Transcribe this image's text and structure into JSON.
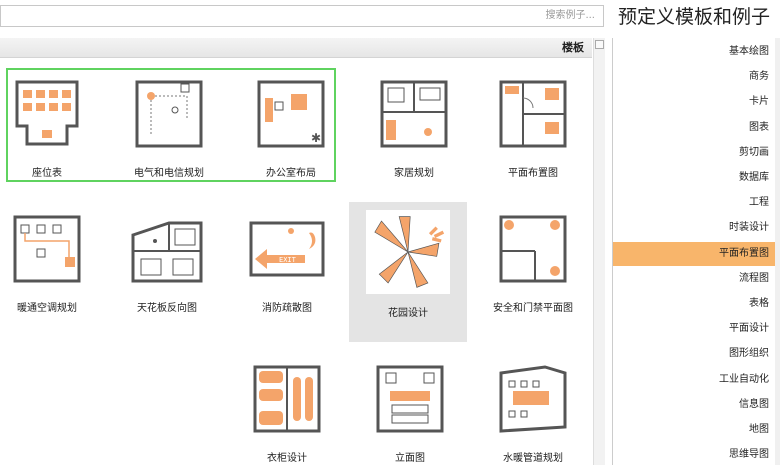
{
  "title": "预定义模板和例子",
  "search": {
    "placeholder": "搜索例子..."
  },
  "main_header": "楼板",
  "sidebar": {
    "items": [
      {
        "label": "基本绘图"
      },
      {
        "label": "商务"
      },
      {
        "label": "卡片"
      },
      {
        "label": "图表"
      },
      {
        "label": "剪切画"
      },
      {
        "label": "数据库"
      },
      {
        "label": "工程"
      },
      {
        "label": "时装设计"
      },
      {
        "label": "平面布置图",
        "active": true
      },
      {
        "label": "流程图"
      },
      {
        "label": "表格"
      },
      {
        "label": "平面设计"
      },
      {
        "label": "图形组织"
      },
      {
        "label": "工业自动化"
      },
      {
        "label": "信息图"
      },
      {
        "label": "地图"
      },
      {
        "label": "思维导图"
      }
    ]
  },
  "tiles": [
    {
      "label": "平面布置图"
    },
    {
      "label": "家居规划"
    },
    {
      "label": "办公室布局"
    },
    {
      "label": "电气和电信规划"
    },
    {
      "label": "座位表"
    },
    {
      "label": "安全和门禁平面图"
    },
    {
      "label": "花园设计"
    },
    {
      "label": "消防疏散图"
    },
    {
      "label": "天花板反向图"
    },
    {
      "label": "暖通空调规划"
    },
    {
      "label": "水暖管道规划"
    },
    {
      "label": "立面图"
    },
    {
      "label": "衣柜设计"
    }
  ],
  "colors": {
    "accent": "#f8b56b",
    "selection": "#5fd35f",
    "line": "#555555",
    "fill": "#f4a46a"
  }
}
